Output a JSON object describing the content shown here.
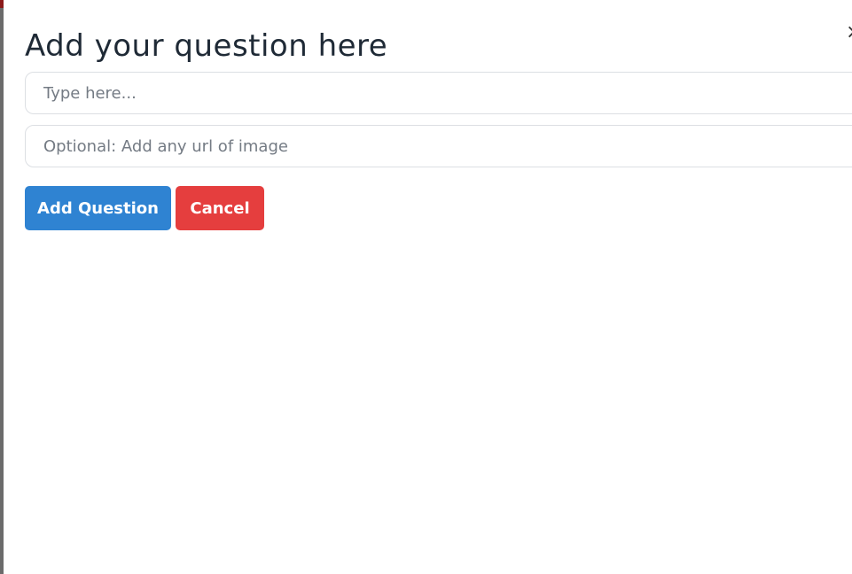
{
  "modal": {
    "title": "Add your question here",
    "close_icon": "close-icon",
    "question_input": {
      "value": "",
      "placeholder": "Type here..."
    },
    "image_url_input": {
      "value": "",
      "placeholder": "Optional: Add any url of image"
    },
    "buttons": {
      "add_label": "Add Question",
      "cancel_label": "Cancel"
    }
  },
  "colors": {
    "primary": "#2f83d2",
    "danger": "#e53e3e",
    "title_text": "#1f2a36",
    "placeholder_text": "#747b84",
    "input_border": "#dcdfe3"
  }
}
